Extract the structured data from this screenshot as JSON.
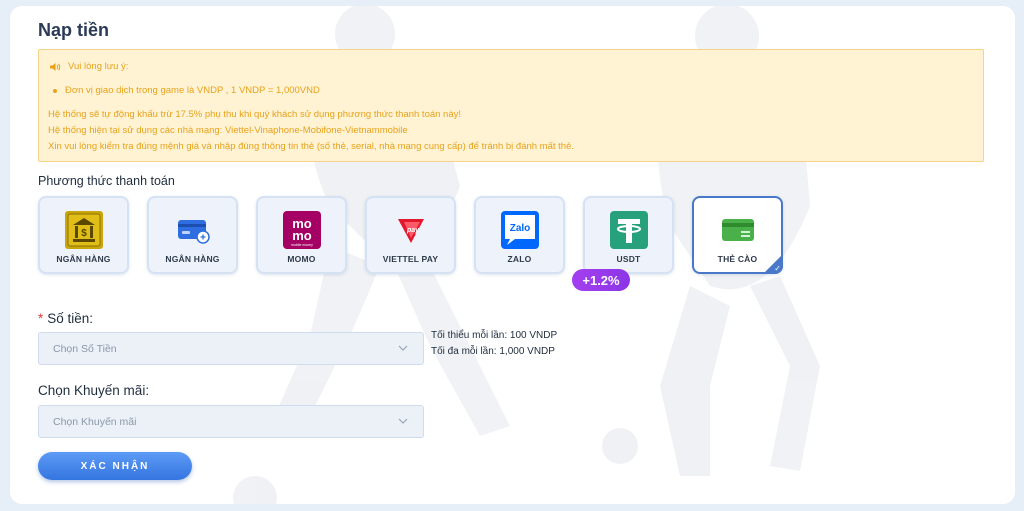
{
  "page": {
    "title": "Nạp tiền"
  },
  "notice": {
    "heading": "Vui lòng lưu ý:",
    "bullet": "Đơn vị giao dịch trong game là VNDP , 1 VNDP = 1,000VND",
    "lines": [
      "Hệ thống sẽ tự động khấu trừ 17.5% phụ thu khi quý khách sử dụng phương thức thanh toán này!",
      "Hệ thống hiện tại sử dụng các nhà mạng: Viettel-Vinaphone-Mobifone-Vietnammobile",
      "Xin vui lòng kiểm tra đúng mệnh giá và nhập đúng thông tin thẻ (số thẻ, serial, nhà mạng cung cấp) để tránh bị đánh mất thẻ."
    ],
    "colors": {
      "text": "#e7a21a",
      "background": "#fff3d4",
      "border": "#f4d38a"
    }
  },
  "payment": {
    "label": "Phương thức thanh toán",
    "methods": [
      {
        "label": "NGÂN HÀNG",
        "icon": "bank-building-icon",
        "selected": false
      },
      {
        "label": "NGÂN HÀNG",
        "icon": "bank-card-icon",
        "selected": false
      },
      {
        "label": "MOMO",
        "icon": "momo-logo-icon",
        "selected": false
      },
      {
        "label": "VIETTEL PAY",
        "icon": "viettel-pay-logo-icon",
        "selected": false
      },
      {
        "label": "ZALO",
        "icon": "zalo-logo-icon",
        "selected": false
      },
      {
        "label": "USDT",
        "icon": "tether-logo-icon",
        "selected": false
      },
      {
        "label": "THẺ CÀO",
        "icon": "scratch-card-icon",
        "selected": true
      }
    ],
    "bonus_badge": "+1.2%",
    "logo_text": {
      "momo": "mo",
      "momo_sub": "mobile money",
      "viettel": "pay",
      "zalo": "Zalo"
    },
    "accent_color": "#4a78c8"
  },
  "amount": {
    "required_mark": "*",
    "label": "Số tiền:",
    "placeholder": "Chọn Số Tiền",
    "min_text": "Tối thiểu mỗi lần: 100 VNDP",
    "max_text": "Tối đa mỗi lần: 1,000 VNDP"
  },
  "promo": {
    "label": "Chọn Khuyến mãi:",
    "placeholder": "Chọn Khuyến mãi"
  },
  "submit": {
    "label": "XÁC NHẬN"
  }
}
